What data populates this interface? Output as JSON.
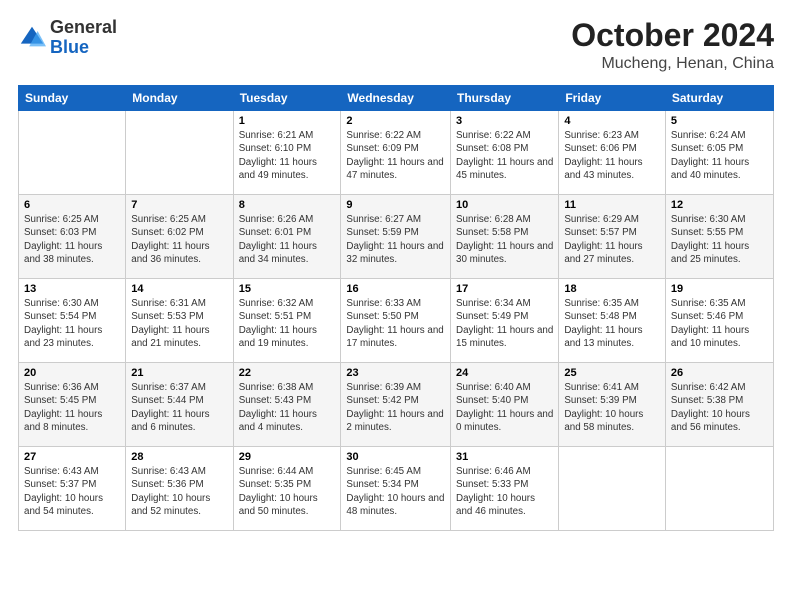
{
  "logo": {
    "general": "General",
    "blue": "Blue"
  },
  "header": {
    "month": "October 2024",
    "location": "Mucheng, Henan, China"
  },
  "weekdays": [
    "Sunday",
    "Monday",
    "Tuesday",
    "Wednesday",
    "Thursday",
    "Friday",
    "Saturday"
  ],
  "weeks": [
    [
      {
        "day": "",
        "info": ""
      },
      {
        "day": "",
        "info": ""
      },
      {
        "day": "1",
        "info": "Sunrise: 6:21 AM\nSunset: 6:10 PM\nDaylight: 11 hours and 49 minutes."
      },
      {
        "day": "2",
        "info": "Sunrise: 6:22 AM\nSunset: 6:09 PM\nDaylight: 11 hours and 47 minutes."
      },
      {
        "day": "3",
        "info": "Sunrise: 6:22 AM\nSunset: 6:08 PM\nDaylight: 11 hours and 45 minutes."
      },
      {
        "day": "4",
        "info": "Sunrise: 6:23 AM\nSunset: 6:06 PM\nDaylight: 11 hours and 43 minutes."
      },
      {
        "day": "5",
        "info": "Sunrise: 6:24 AM\nSunset: 6:05 PM\nDaylight: 11 hours and 40 minutes."
      }
    ],
    [
      {
        "day": "6",
        "info": "Sunrise: 6:25 AM\nSunset: 6:03 PM\nDaylight: 11 hours and 38 minutes."
      },
      {
        "day": "7",
        "info": "Sunrise: 6:25 AM\nSunset: 6:02 PM\nDaylight: 11 hours and 36 minutes."
      },
      {
        "day": "8",
        "info": "Sunrise: 6:26 AM\nSunset: 6:01 PM\nDaylight: 11 hours and 34 minutes."
      },
      {
        "day": "9",
        "info": "Sunrise: 6:27 AM\nSunset: 5:59 PM\nDaylight: 11 hours and 32 minutes."
      },
      {
        "day": "10",
        "info": "Sunrise: 6:28 AM\nSunset: 5:58 PM\nDaylight: 11 hours and 30 minutes."
      },
      {
        "day": "11",
        "info": "Sunrise: 6:29 AM\nSunset: 5:57 PM\nDaylight: 11 hours and 27 minutes."
      },
      {
        "day": "12",
        "info": "Sunrise: 6:30 AM\nSunset: 5:55 PM\nDaylight: 11 hours and 25 minutes."
      }
    ],
    [
      {
        "day": "13",
        "info": "Sunrise: 6:30 AM\nSunset: 5:54 PM\nDaylight: 11 hours and 23 minutes."
      },
      {
        "day": "14",
        "info": "Sunrise: 6:31 AM\nSunset: 5:53 PM\nDaylight: 11 hours and 21 minutes."
      },
      {
        "day": "15",
        "info": "Sunrise: 6:32 AM\nSunset: 5:51 PM\nDaylight: 11 hours and 19 minutes."
      },
      {
        "day": "16",
        "info": "Sunrise: 6:33 AM\nSunset: 5:50 PM\nDaylight: 11 hours and 17 minutes."
      },
      {
        "day": "17",
        "info": "Sunrise: 6:34 AM\nSunset: 5:49 PM\nDaylight: 11 hours and 15 minutes."
      },
      {
        "day": "18",
        "info": "Sunrise: 6:35 AM\nSunset: 5:48 PM\nDaylight: 11 hours and 13 minutes."
      },
      {
        "day": "19",
        "info": "Sunrise: 6:35 AM\nSunset: 5:46 PM\nDaylight: 11 hours and 10 minutes."
      }
    ],
    [
      {
        "day": "20",
        "info": "Sunrise: 6:36 AM\nSunset: 5:45 PM\nDaylight: 11 hours and 8 minutes."
      },
      {
        "day": "21",
        "info": "Sunrise: 6:37 AM\nSunset: 5:44 PM\nDaylight: 11 hours and 6 minutes."
      },
      {
        "day": "22",
        "info": "Sunrise: 6:38 AM\nSunset: 5:43 PM\nDaylight: 11 hours and 4 minutes."
      },
      {
        "day": "23",
        "info": "Sunrise: 6:39 AM\nSunset: 5:42 PM\nDaylight: 11 hours and 2 minutes."
      },
      {
        "day": "24",
        "info": "Sunrise: 6:40 AM\nSunset: 5:40 PM\nDaylight: 11 hours and 0 minutes."
      },
      {
        "day": "25",
        "info": "Sunrise: 6:41 AM\nSunset: 5:39 PM\nDaylight: 10 hours and 58 minutes."
      },
      {
        "day": "26",
        "info": "Sunrise: 6:42 AM\nSunset: 5:38 PM\nDaylight: 10 hours and 56 minutes."
      }
    ],
    [
      {
        "day": "27",
        "info": "Sunrise: 6:43 AM\nSunset: 5:37 PM\nDaylight: 10 hours and 54 minutes."
      },
      {
        "day": "28",
        "info": "Sunrise: 6:43 AM\nSunset: 5:36 PM\nDaylight: 10 hours and 52 minutes."
      },
      {
        "day": "29",
        "info": "Sunrise: 6:44 AM\nSunset: 5:35 PM\nDaylight: 10 hours and 50 minutes."
      },
      {
        "day": "30",
        "info": "Sunrise: 6:45 AM\nSunset: 5:34 PM\nDaylight: 10 hours and 48 minutes."
      },
      {
        "day": "31",
        "info": "Sunrise: 6:46 AM\nSunset: 5:33 PM\nDaylight: 10 hours and 46 minutes."
      },
      {
        "day": "",
        "info": ""
      },
      {
        "day": "",
        "info": ""
      }
    ]
  ]
}
